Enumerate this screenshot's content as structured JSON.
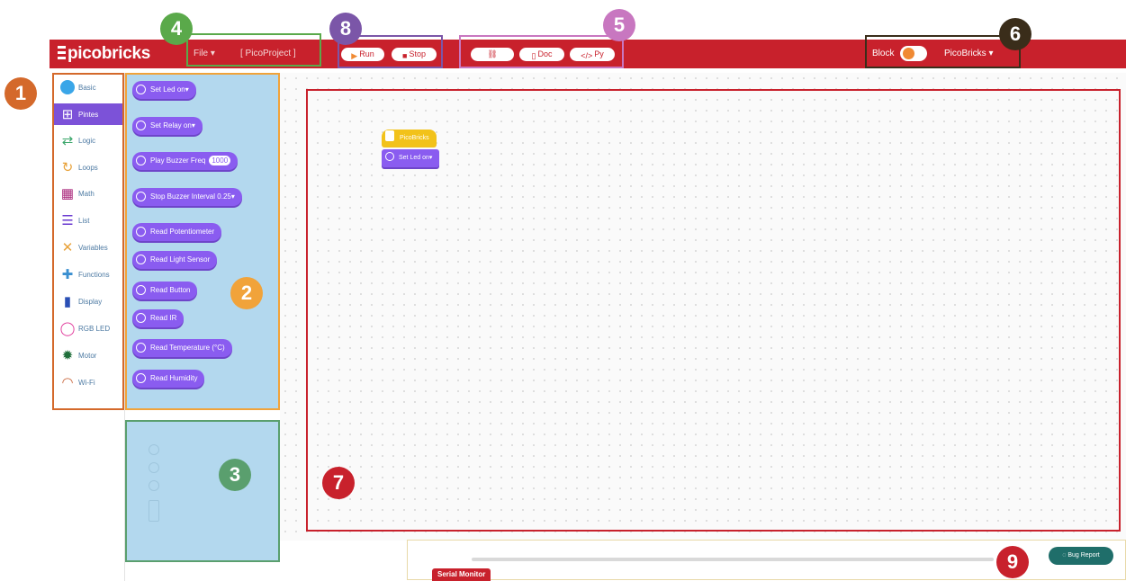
{
  "app": {
    "logo": "picobricks"
  },
  "topbar": {
    "file_menu": "File",
    "file_caret": "▾",
    "project_name": "[ PicoProject ]",
    "run_label": "Run",
    "stop_label": "Stop",
    "device_label": "Doc",
    "py_label": "Py",
    "block_mode_label": "Block",
    "device_select": "PicoBricks",
    "device_caret": "▾"
  },
  "sidebar": {
    "items": [
      {
        "label": "Basic",
        "icon": "circle-icon"
      },
      {
        "label": "Pintes",
        "icon": "grid-icon"
      },
      {
        "label": "Logic",
        "icon": "arrows-icon"
      },
      {
        "label": "Loops",
        "icon": "loop-icon"
      },
      {
        "label": "Math",
        "icon": "calculator-icon"
      },
      {
        "label": "List",
        "icon": "list-icon"
      },
      {
        "label": "Variables",
        "icon": "variable-icon"
      },
      {
        "label": "Functions",
        "icon": "puzzle-icon"
      },
      {
        "label": "Display",
        "icon": "display-icon"
      },
      {
        "label": "RGB LED",
        "icon": "ring-icon"
      },
      {
        "label": "Motor",
        "icon": "gear-icon"
      },
      {
        "label": "Wi-Fi",
        "icon": "wifi-icon"
      }
    ]
  },
  "flyout": {
    "blocks": [
      {
        "label": "Set Led",
        "value": "on▾"
      },
      {
        "label": "Set Relay",
        "value": "on▾"
      },
      {
        "label": "Play Buzzer  Freq",
        "value": "1000"
      },
      {
        "label": "Stop Buzzer  Interval",
        "value": "0.25▾"
      },
      {
        "label": "Read Potentiometer",
        "value": ""
      },
      {
        "label": "Read Light Sensor",
        "value": ""
      },
      {
        "label": "Read Button",
        "value": ""
      },
      {
        "label": "Read IR",
        "value": ""
      },
      {
        "label": "Read Temperature (°C)",
        "value": ""
      },
      {
        "label": "Read Humidity",
        "value": ""
      }
    ]
  },
  "workspace": {
    "hat_block": "PicoBricks",
    "set_led_block": "Set Led   on▾"
  },
  "bottom": {
    "serial_monitor": "Serial Monitor",
    "bug_report": "Bug Report"
  },
  "badges": [
    "1",
    "2",
    "3",
    "4",
    "5",
    "6",
    "7",
    "8",
    "9"
  ],
  "colors": {
    "brand_red": "#c8212c",
    "block_purple": "#8a5cf0",
    "flyout_blue": "#b3d8ee",
    "badge_1": "#d4692b",
    "badge_2": "#f1a33a",
    "badge_3": "#5a9f6e",
    "badge_4": "#5aa94a",
    "badge_5": "#c877c0",
    "badge_6": "#3a2d1a",
    "badge_7": "#c8212c",
    "badge_8": "#7b56a8",
    "badge_9": "#c8212c"
  }
}
